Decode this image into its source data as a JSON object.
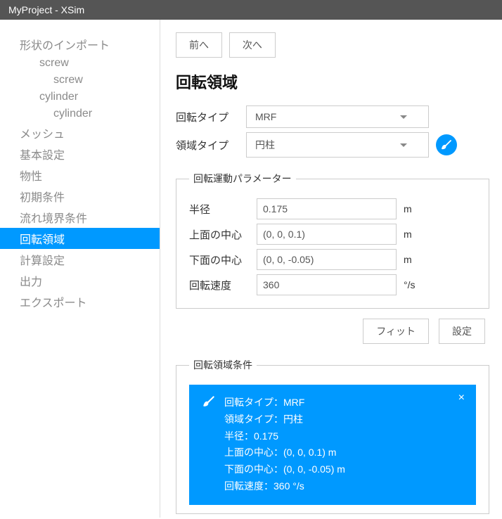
{
  "titlebar": "MyProject - XSim",
  "sidebar": {
    "items": [
      {
        "label": "形状のインポート",
        "lvl": 0
      },
      {
        "label": "screw",
        "lvl": 1
      },
      {
        "label": "screw",
        "lvl": 2
      },
      {
        "label": "cylinder",
        "lvl": 1
      },
      {
        "label": "cylinder",
        "lvl": 2
      },
      {
        "label": "メッシュ",
        "lvl": 0
      },
      {
        "label": "基本設定",
        "lvl": 0
      },
      {
        "label": "物性",
        "lvl": 0
      },
      {
        "label": "初期条件",
        "lvl": 0
      },
      {
        "label": "流れ境界条件",
        "lvl": 0
      },
      {
        "label": "回転領域",
        "lvl": 0,
        "active": true
      },
      {
        "label": "計算設定",
        "lvl": 0
      },
      {
        "label": "出力",
        "lvl": 0
      },
      {
        "label": "エクスポート",
        "lvl": 0
      }
    ]
  },
  "nav": {
    "prev": "前へ",
    "next": "次へ"
  },
  "heading": "回転領域",
  "typeRow": {
    "rotLabel": "回転タイプ",
    "rotValue": "MRF",
    "areaLabel": "領域タイプ",
    "areaValue": "円柱"
  },
  "paramBox": {
    "legend": "回転運動パラメーター",
    "rows": [
      {
        "label": "半径",
        "value": "0.175",
        "unit": "m"
      },
      {
        "label": "上面の中心",
        "value": "(0, 0, 0.1)",
        "unit": "m"
      },
      {
        "label": "下面の中心",
        "value": "(0, 0, -0.05)",
        "unit": "m"
      },
      {
        "label": "回転速度",
        "value": "360",
        "unit": "°/s"
      }
    ]
  },
  "actions": {
    "fit": "フィット",
    "set": "設定"
  },
  "condBox": {
    "legend": "回転領域条件",
    "lines": [
      "回転タイプ：MRF",
      "領域タイプ：円柱",
      "半径：0.175",
      "上面の中心：(0, 0, 0.1) m",
      "下面の中心：(0, 0, -0.05) m",
      "回転速度：360 °/s"
    ]
  }
}
